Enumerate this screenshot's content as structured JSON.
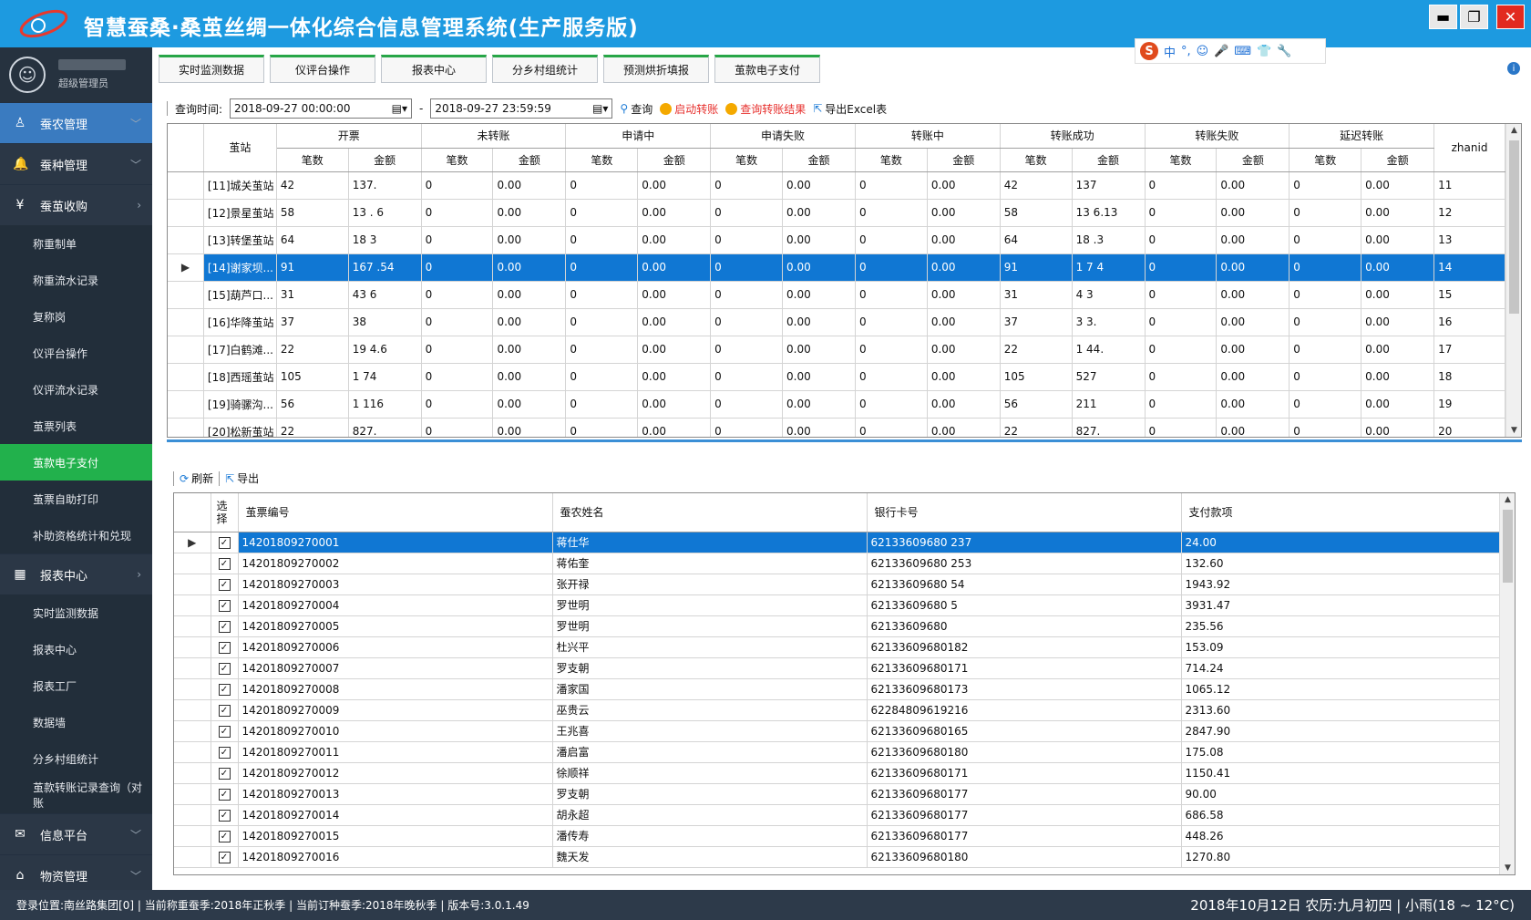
{
  "app": {
    "title": "智慧蚕桑·桑茧丝绸一体化综合信息管理系统(生产服务版)"
  },
  "window_controls": {
    "minimize": "▬",
    "restore": "❐",
    "close": "✕"
  },
  "ime": {
    "logo": "S",
    "label": "中",
    "items": [
      "°,",
      "☺",
      "🎤",
      "⌨",
      "👕",
      "🔧"
    ]
  },
  "user": {
    "role": "超级管理员"
  },
  "sidebar": [
    {
      "label": "蚕农管理",
      "type": "group",
      "icon": "person-icon",
      "glyph": "♙",
      "open": true
    },
    {
      "label": "蚕种管理",
      "type": "group",
      "icon": "bell-icon",
      "glyph": "🔔"
    },
    {
      "label": "蚕茧收购",
      "type": "group",
      "icon": "yen-icon",
      "glyph": "¥",
      "chev": "›"
    },
    {
      "label": "称重制单",
      "type": "sub"
    },
    {
      "label": "称重流水记录",
      "type": "sub"
    },
    {
      "label": "复称岗",
      "type": "sub"
    },
    {
      "label": "仪评台操作",
      "type": "sub"
    },
    {
      "label": "仪评流水记录",
      "type": "sub"
    },
    {
      "label": "茧票列表",
      "type": "sub"
    },
    {
      "label": "茧款电子支付",
      "type": "sub",
      "active": true
    },
    {
      "label": "茧票自助打印",
      "type": "sub"
    },
    {
      "label": "补助资格统计和兑现",
      "type": "sub"
    },
    {
      "label": "报表中心",
      "type": "group",
      "icon": "table-icon",
      "glyph": "▦",
      "chev": "›"
    },
    {
      "label": "实时监测数据",
      "type": "sub"
    },
    {
      "label": "报表中心",
      "type": "sub"
    },
    {
      "label": "报表工厂",
      "type": "sub"
    },
    {
      "label": "数据墙",
      "type": "sub"
    },
    {
      "label": "分乡村组统计",
      "type": "sub"
    },
    {
      "label": "茧款转账记录查询（对账",
      "type": "sub"
    },
    {
      "label": "信息平台",
      "type": "group",
      "icon": "mail-icon",
      "glyph": "✉"
    },
    {
      "label": "物资管理",
      "type": "group",
      "icon": "home-icon",
      "glyph": "⌂"
    }
  ],
  "tabs": [
    "实时监测数据",
    "仪评台操作",
    "报表中心",
    "分乡村组统计",
    "预测烘折填报",
    "茧款电子支付"
  ],
  "query": {
    "label": "查询时间:",
    "start": "2018-09-27 00:00:00",
    "dash": "-",
    "end": "2018-09-27 23:59:59",
    "search": "查询",
    "start_transfer": "启动转账",
    "query_result": "查询转账结果",
    "export_excel": "导出Excel表"
  },
  "summary": {
    "station_header": "茧站",
    "groups": [
      "开票",
      "未转账",
      "申请中",
      "申请失败",
      "转账中",
      "转账成功",
      "转账失败",
      "延迟转账"
    ],
    "sub_headers": [
      "笔数",
      "金额"
    ],
    "last_header": "zhanid",
    "rows": [
      {
        "station": "[11]城关茧站",
        "cells": [
          "42",
          "137.",
          "0",
          "0.00",
          "0",
          "0.00",
          "0",
          "0.00",
          "0",
          "0.00",
          "42",
          "137",
          "0",
          "0.00",
          "0",
          "0.00"
        ],
        "zhanid": "11"
      },
      {
        "station": "[12]景星茧站",
        "cells": [
          "58",
          "13   .  6",
          "0",
          "0.00",
          "0",
          "0.00",
          "0",
          "0.00",
          "0",
          "0.00",
          "58",
          "13    6.13",
          "0",
          "0.00",
          "0",
          "0.00"
        ],
        "zhanid": "12"
      },
      {
        "station": "[13]转堡茧站",
        "cells": [
          "64",
          "18    3",
          "0",
          "0.00",
          "0",
          "0.00",
          "0",
          "0.00",
          "0",
          "0.00",
          "64",
          "18    .3",
          "0",
          "0.00",
          "0",
          "0.00"
        ],
        "zhanid": "13"
      },
      {
        "station": "[14]谢家坝...",
        "cells": [
          "91",
          "167   .54",
          "0",
          "0.00",
          "0",
          "0.00",
          "0",
          "0.00",
          "0",
          "0.00",
          "91",
          "1   7   4",
          "0",
          "0.00",
          "0",
          "0.00"
        ],
        "zhanid": "14",
        "selected": true
      },
      {
        "station": "[15]葫芦口...",
        "cells": [
          "31",
          "43    6",
          "0",
          "0.00",
          "0",
          "0.00",
          "0",
          "0.00",
          "0",
          "0.00",
          "31",
          "4   3",
          "0",
          "0.00",
          "0",
          "0.00"
        ],
        "zhanid": "15"
      },
      {
        "station": "[16]华降茧站",
        "cells": [
          "37",
          "38",
          "0",
          "0.00",
          "0",
          "0.00",
          "0",
          "0.00",
          "0",
          "0.00",
          "37",
          "3   3.",
          "0",
          "0.00",
          "0",
          "0.00"
        ],
        "zhanid": "16"
      },
      {
        "station": "[17]白鹤滩...",
        "cells": [
          "22",
          "19   4.6",
          "0",
          "0.00",
          "0",
          "0.00",
          "0",
          "0.00",
          "0",
          "0.00",
          "22",
          "1   44.",
          "0",
          "0.00",
          "0",
          "0.00"
        ],
        "zhanid": "17"
      },
      {
        "station": "[18]西瑶茧站",
        "cells": [
          "105",
          "1    74",
          "0",
          "0.00",
          "0",
          "0.00",
          "0",
          "0.00",
          "0",
          "0.00",
          "105",
          "527",
          "0",
          "0.00",
          "0",
          "0.00"
        ],
        "zhanid": "18"
      },
      {
        "station": "[19]骑骡沟...",
        "cells": [
          "56",
          "1   116",
          "0",
          "0.00",
          "0",
          "0.00",
          "0",
          "0.00",
          "0",
          "0.00",
          "56",
          "211",
          "0",
          "0.00",
          "0",
          "0.00"
        ],
        "zhanid": "19"
      },
      {
        "station": "[20]松新茧站",
        "cells": [
          "22",
          "827.",
          "0",
          "0.00",
          "0",
          "0.00",
          "0",
          "0.00",
          "0",
          "0.00",
          "22",
          "827.",
          "0",
          "0.00",
          "0",
          "0.00"
        ],
        "zhanid": "20"
      }
    ]
  },
  "detail_toolbar": {
    "refresh": "刷新",
    "export": "导出"
  },
  "detail": {
    "headers": [
      "选择",
      "茧票编号",
      "蚕农姓名",
      "银行卡号",
      "支付款项"
    ],
    "rows": [
      {
        "ticket": "14201809270001",
        "name": "蒋仕华",
        "card": "62133609680   237",
        "amount": "24.00",
        "selected": true
      },
      {
        "ticket": "14201809270002",
        "name": "蒋佑奎",
        "card": "62133609680   253",
        "amount": "132.60"
      },
      {
        "ticket": "14201809270003",
        "name": "张开禄",
        "card": "62133609680   54",
        "amount": "1943.92"
      },
      {
        "ticket": "14201809270004",
        "name": "罗世明",
        "card": "62133609680   5",
        "amount": "3931.47"
      },
      {
        "ticket": "14201809270005",
        "name": "罗世明",
        "card": "62133609680   ",
        "amount": "235.56"
      },
      {
        "ticket": "14201809270006",
        "name": "杜兴平",
        "card": "62133609680182",
        "amount": "153.09"
      },
      {
        "ticket": "14201809270007",
        "name": "罗支朝",
        "card": "62133609680171",
        "amount": "714.24"
      },
      {
        "ticket": "14201809270008",
        "name": "潘家国",
        "card": "62133609680173",
        "amount": "1065.12"
      },
      {
        "ticket": "14201809270009",
        "name": "巫贵云",
        "card": "62284809619216",
        "amount": "2313.60"
      },
      {
        "ticket": "14201809270010",
        "name": "王兆喜",
        "card": "62133609680165",
        "amount": "2847.90"
      },
      {
        "ticket": "14201809270011",
        "name": "潘启富",
        "card": "62133609680180",
        "amount": "175.08"
      },
      {
        "ticket": "14201809270012",
        "name": "徐顺祥",
        "card": "62133609680171",
        "amount": "1150.41"
      },
      {
        "ticket": "14201809270013",
        "name": "罗支朝",
        "card": "62133609680177",
        "amount": "90.00"
      },
      {
        "ticket": "14201809270014",
        "name": "胡永超",
        "card": "62133609680177",
        "amount": "686.58"
      },
      {
        "ticket": "14201809270015",
        "name": "潘传寿",
        "card": "62133609680177",
        "amount": "448.26"
      },
      {
        "ticket": "14201809270016",
        "name": "魏天发",
        "card": "62133609680180",
        "amount": "1270.80"
      }
    ]
  },
  "status": {
    "left": "登录位置:南丝路集团[0] | 当前称重蚕季:2018年正秋季 | 当前订种蚕季:2018年晚秋季 | 版本号:3.0.1.49",
    "right": "2018年10月12日 农历:九月初四 | 小雨(18 ~ 12°C)"
  },
  "colors": {
    "titlebar": "#1d9ae0",
    "sidebar": "#2d3a4a",
    "active": "#22b14c",
    "selection": "#1077d3"
  }
}
